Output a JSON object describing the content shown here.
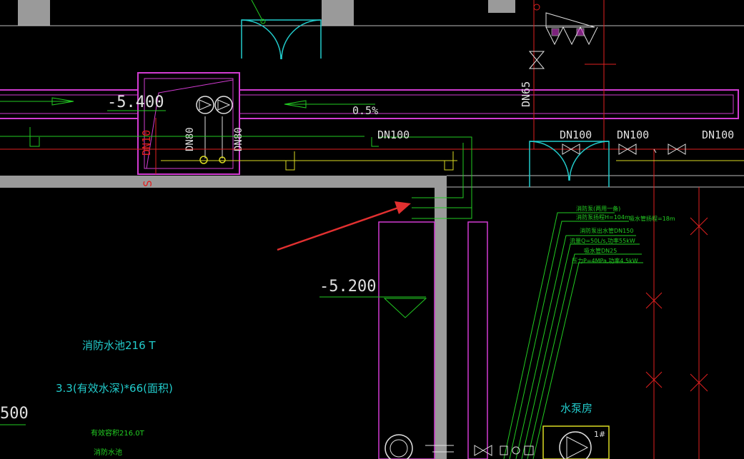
{
  "labels": {
    "elev_top": "-5.400",
    "slope": "0.5%",
    "dn100_1": "DN100",
    "dn100_2": "DN100",
    "dn100_3": "DN100",
    "dn100_4": "DN100",
    "dn65": "DN65",
    "dn80_a": "DN80",
    "dn80_b": "DN80",
    "dn_left": "DN10",
    "s_mark": "S",
    "elev_mid": "-5.200",
    "pool_name": "消防水池216 T",
    "pool_formula": "3.3(有效水深)*66(面积)",
    "pool_small1": "有效容积216.0T",
    "pool_small2": "消防水池",
    "elev_left_partial": "500",
    "pump_room": "水泵房",
    "pump_no": "1#"
  },
  "notes": [
    "消防泵(两用一备)",
    "消防泵扬程H=104m",
    "消防泵出水管DN150",
    "流量Q=50L/s,功率55kW",
    "吸水管DN25",
    "压力P=4MPa,功率4.5kW"
  ],
  "notes_right": "吸水管扬程=18m",
  "colors": {
    "background": "#000000",
    "wall": "#9a9a9a",
    "magenta": "#d23bd2",
    "green": "#22cc22",
    "cyan": "#22cccc",
    "red": "#e02020",
    "yellow": "#dada22",
    "white": "#e0e0e0",
    "arrow": "#e23030"
  }
}
